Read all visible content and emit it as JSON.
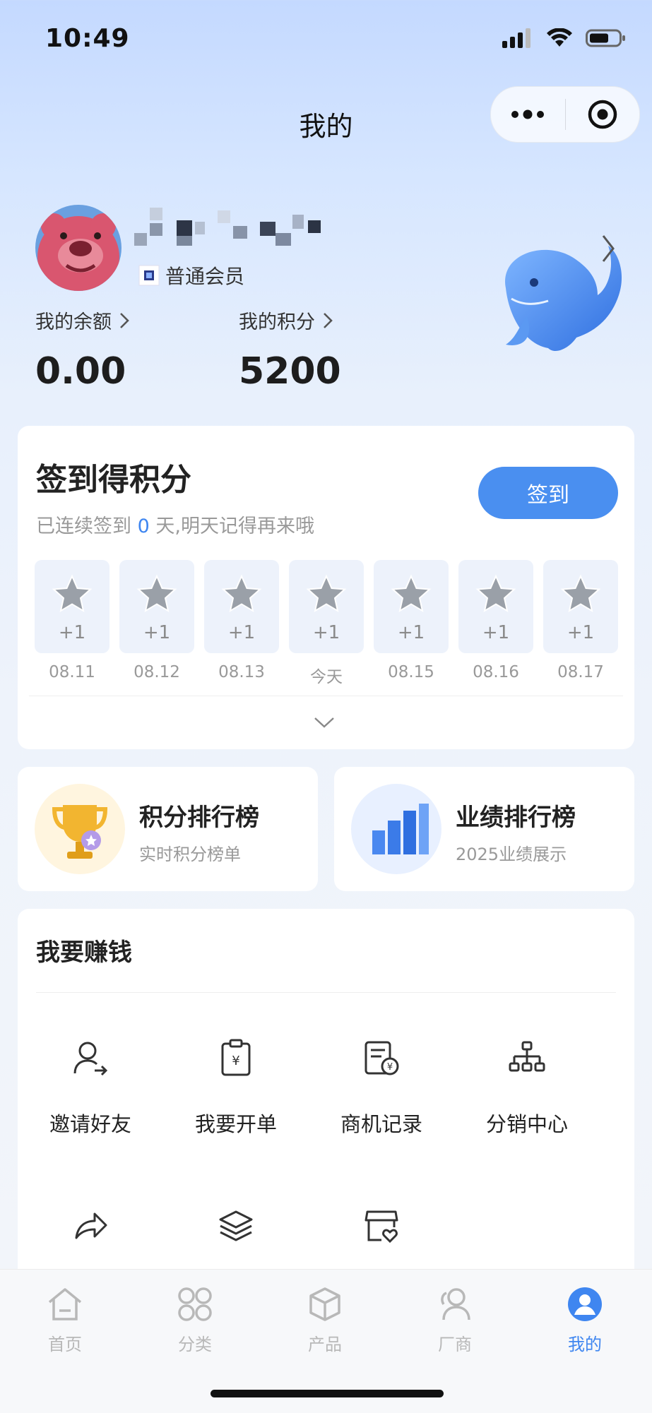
{
  "status_bar": {
    "time": "10:49"
  },
  "header": {
    "title": "我的"
  },
  "profile": {
    "member_level": "普通会员",
    "balance_label": "我的余额",
    "balance_value": "0.00",
    "points_label": "我的积分",
    "points_value": "5200"
  },
  "checkin": {
    "title": "签到得积分",
    "subtitle_prefix": "已连续签到",
    "streak": "0",
    "subtitle_suffix": "天,明天记得再来哦",
    "button": "签到",
    "days": [
      {
        "reward": "+1",
        "date": "08.11"
      },
      {
        "reward": "+1",
        "date": "08.12"
      },
      {
        "reward": "+1",
        "date": "08.13"
      },
      {
        "reward": "+1",
        "date": "今天"
      },
      {
        "reward": "+1",
        "date": "08.15"
      },
      {
        "reward": "+1",
        "date": "08.16"
      },
      {
        "reward": "+1",
        "date": "08.17"
      }
    ]
  },
  "rankings": {
    "points": {
      "title": "积分排行榜",
      "subtitle": "实时积分榜单"
    },
    "sales": {
      "title": "业绩排行榜",
      "subtitle": "2025业绩展示"
    }
  },
  "earn": {
    "title": "我要赚钱",
    "tools": [
      {
        "label": "邀请好友",
        "icon": "invite-user-icon"
      },
      {
        "label": "我要开单",
        "icon": "order-clipboard-icon"
      },
      {
        "label": "商机记录",
        "icon": "opportunity-record-icon"
      },
      {
        "label": "分销中心",
        "icon": "distribution-tree-icon"
      },
      {
        "label": "",
        "icon": "share-icon"
      },
      {
        "label": "",
        "icon": "layers-icon"
      },
      {
        "label": "",
        "icon": "store-heart-icon"
      }
    ]
  },
  "tabbar": {
    "tabs": [
      {
        "label": "首页",
        "icon": "home-icon"
      },
      {
        "label": "分类",
        "icon": "category-icon"
      },
      {
        "label": "产品",
        "icon": "product-box-icon"
      },
      {
        "label": "厂商",
        "icon": "vendor-icon"
      },
      {
        "label": "我的",
        "icon": "profile-icon",
        "active": true
      }
    ]
  },
  "colors": {
    "accent": "#3f86f0",
    "button": "#4a8ff0"
  }
}
